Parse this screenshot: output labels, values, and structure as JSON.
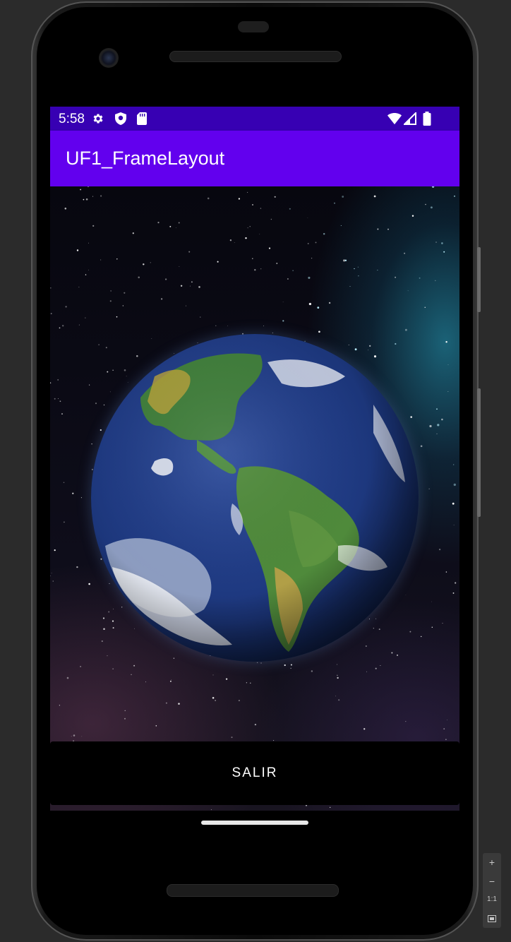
{
  "status_bar": {
    "time": "5:58",
    "left_icons": [
      "settings-gear-icon",
      "shield-icon",
      "sd-card-icon"
    ],
    "right_icons": [
      "wifi-icon",
      "signal-icon",
      "battery-icon"
    ],
    "color": "#3700b3"
  },
  "app_bar": {
    "title": "UF1_FrameLayout",
    "color": "#6200ee"
  },
  "content": {
    "background_image": "earth-in-space-image"
  },
  "exit_button": {
    "label": "SALIR"
  },
  "emulator_controls": {
    "zoom_in": "+",
    "zoom_out": "−",
    "actual_size": "1:1",
    "fit_screen_icon": "fit-screen-icon"
  }
}
